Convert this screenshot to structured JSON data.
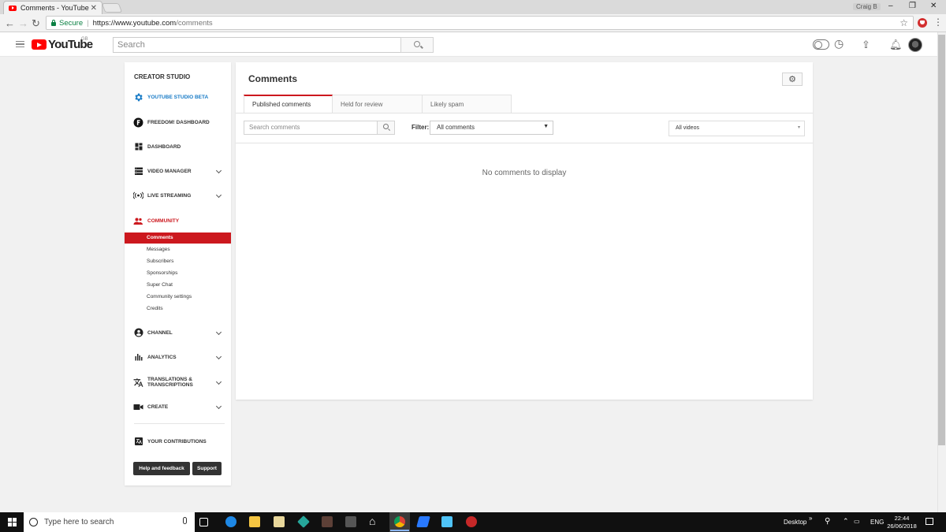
{
  "browser": {
    "tab_title": "Comments - YouTube",
    "tab_close": "✕",
    "profile_name": "Craig B",
    "secure_label": "Secure",
    "url_host": "https://www.youtube.com",
    "url_path": "/comments"
  },
  "yt_header": {
    "logo_text": "YouTube",
    "region": "GB",
    "search_placeholder": "Search"
  },
  "sidebar": {
    "title": "CREATOR STUDIO",
    "items": [
      {
        "label": "YOUTUBE STUDIO BETA",
        "icon": "gear-icon"
      },
      {
        "label": "FREEDOM! DASHBOARD",
        "icon": "freedom-logo-icon"
      },
      {
        "label": "DASHBOARD",
        "icon": "dashboard-icon"
      },
      {
        "label": "VIDEO MANAGER",
        "icon": "video-manager-icon"
      },
      {
        "label": "LIVE STREAMING",
        "icon": "live-icon"
      },
      {
        "label": "COMMUNITY",
        "icon": "community-icon"
      }
    ],
    "community_sub": [
      "Comments",
      "Messages",
      "Subscribers",
      "Sponsorships",
      "Super Chat",
      "Community settings",
      "Credits"
    ],
    "items2": [
      {
        "label": "CHANNEL",
        "icon": "channel-icon"
      },
      {
        "label": "ANALYTICS",
        "icon": "analytics-icon"
      },
      {
        "label": "TRANSLATIONS &",
        "label2": "TRANSCRIPTIONS",
        "icon": "translate-icon"
      },
      {
        "label": "CREATE",
        "icon": "create-icon"
      }
    ],
    "contributions": "YOUR CONTRIBUTIONS",
    "help_btn": "Help and feedback",
    "support_btn": "Support"
  },
  "main": {
    "title": "Comments",
    "tabs": [
      "Published comments",
      "Held for review",
      "Likely spam"
    ],
    "search_placeholder": "Search comments",
    "filter_label": "Filter:",
    "filter_value": "All comments",
    "videos_value": "All videos",
    "empty_message": "No comments to display"
  },
  "taskbar": {
    "search_placeholder": "Type here to search",
    "desktop_label": "Desktop",
    "lang": "ENG",
    "time": "22:44",
    "date": "26/06/2018"
  },
  "colors": {
    "accent_red": "#cc181e",
    "studio_blue": "#167ac6",
    "youtube_red": "#ff0000"
  }
}
